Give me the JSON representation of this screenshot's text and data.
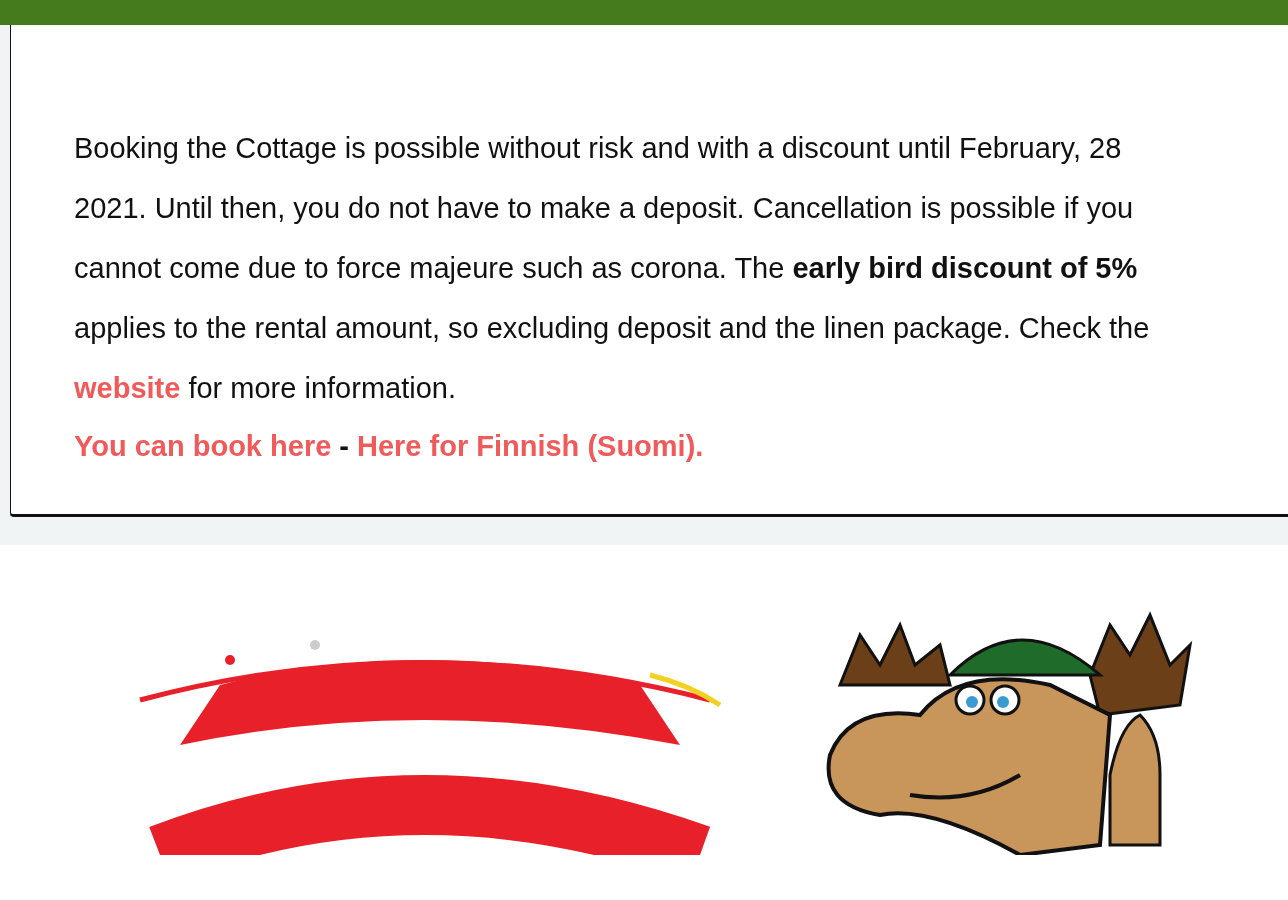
{
  "notice": {
    "text_before": "Booking the Cottage is possible without risk and with a discount until February, 28 2021. Until then, you do not have to make a deposit. Cancellation is possible if you cannot come due to force majeure such as corona. The **early bird discount of 5%** applies to the rental amount, so excluding deposit and the linen package. Check the",
    "link": "website",
    "text_after": "for more information.",
    "links": [
      "You can book here",
      "Here for Finnish (Suomi)."
    ],
    "separator": "-"
  }
}
